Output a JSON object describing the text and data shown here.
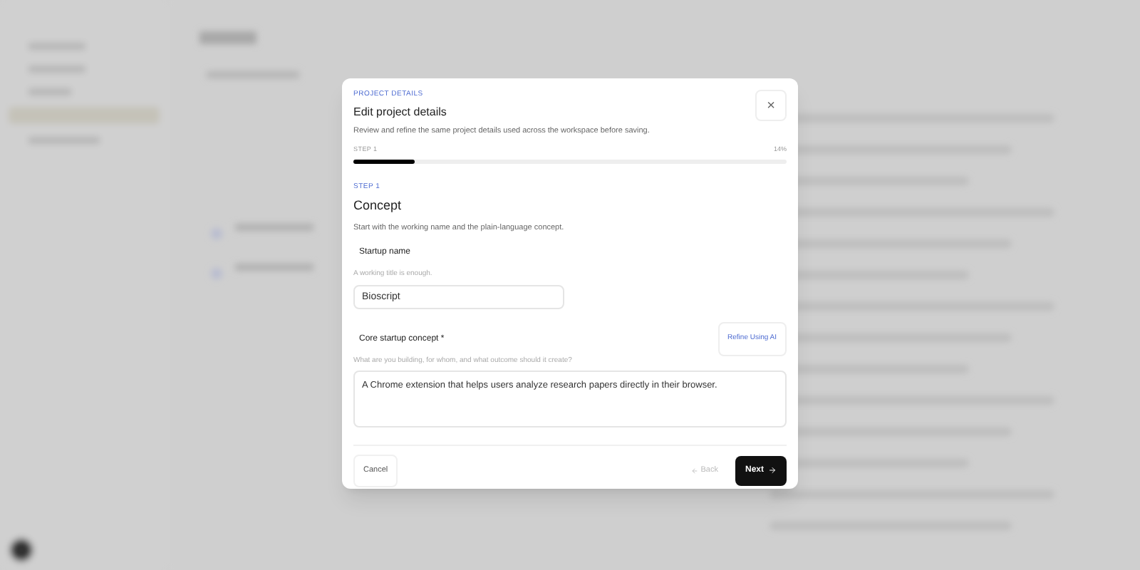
{
  "dialog": {
    "eyebrow": "PROJECT DETAILS",
    "title": "Edit project details",
    "description": "Review and refine the same project details used across the workspace before saving.",
    "close": "×",
    "progress": {
      "label": "STEP 1",
      "reading": "14%",
      "level": 0.14
    },
    "step": {
      "eyebrow": "STEP 1",
      "title": "Concept",
      "description": "Start with the working name and the plain-language concept."
    },
    "fields": [
      {
        "kind": "input",
        "label": "Startup name",
        "hint": "A working title is enough.",
        "value": "Bioscript"
      },
      {
        "kind": "textarea",
        "label": "Core startup concept *",
        "hint": "What are you building, for whom, and what outcome should it create?",
        "value": "A Chrome extension that helps users analyze research papers directly in their browser.",
        "action": "Refine Using AI"
      }
    ],
    "footer": {
      "cancel": "Cancel",
      "back": {
        "label": "Back",
        "disabled": true
      },
      "next": "Next"
    }
  }
}
